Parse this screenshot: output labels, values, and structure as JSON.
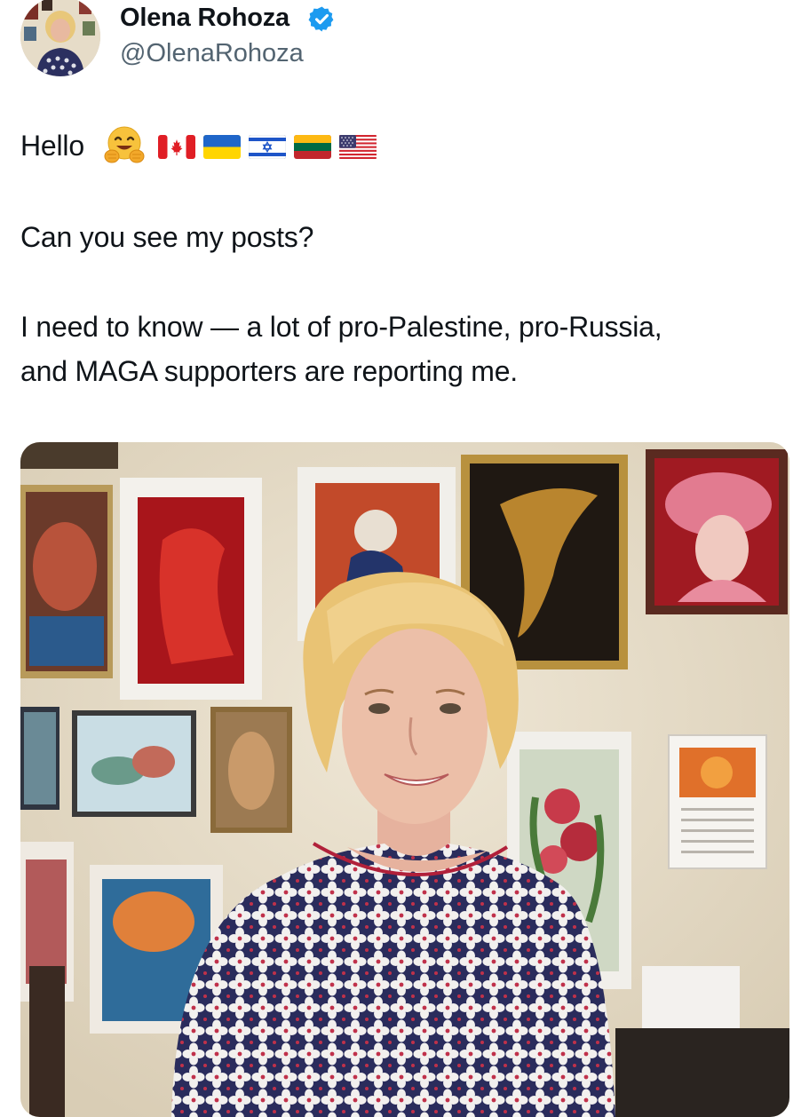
{
  "author": {
    "display_name": "Olena Rohoza",
    "handle": "@OlenaRohoza",
    "verified_icon": "verified-badge-icon",
    "accent_color": "#1d9bf0"
  },
  "tweet": {
    "greeting": "Hello",
    "emojis": [
      "hugging-face",
      "flag-canada",
      "flag-ukraine",
      "flag-israel",
      "flag-lithuania",
      "flag-united-states"
    ],
    "line_2": "Can you see my posts?",
    "line_3": "I need to know — a lot of pro-Palestine, pro-Russia,",
    "line_4": "and MAGA supporters are reporting me."
  },
  "media": {
    "type": "photo"
  }
}
